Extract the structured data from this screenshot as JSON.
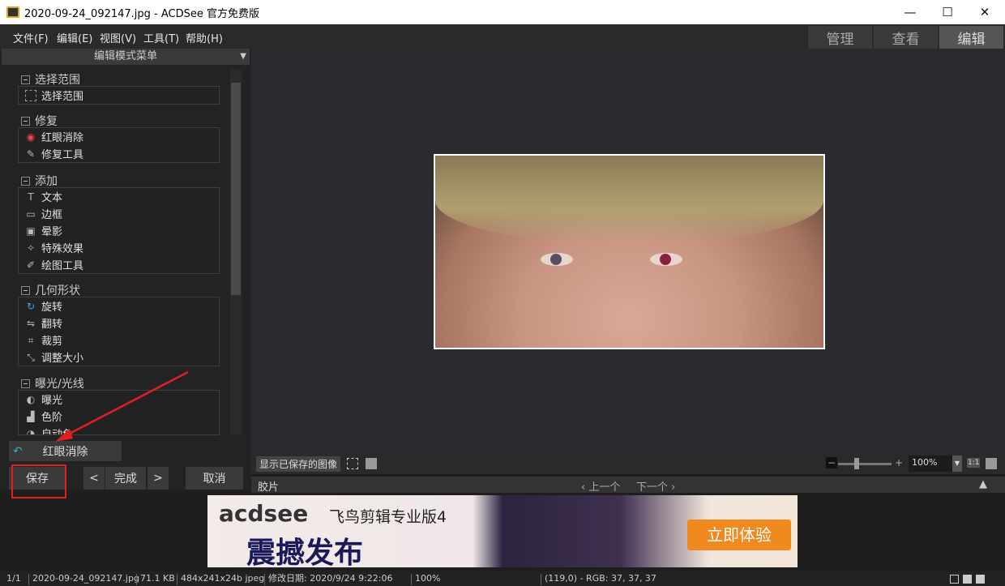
{
  "title": "2020-09-24_092147.jpg - ACDSee 官方免费版",
  "window_controls": {
    "minimize": "—",
    "maximize": "☐",
    "close": "✕"
  },
  "menu": [
    "文件(F)",
    "编辑(E)",
    "视图(V)",
    "工具(T)",
    "帮助(H)"
  ],
  "modes": [
    "管理",
    "查看",
    "编辑"
  ],
  "active_mode": "编辑",
  "panel": {
    "header": "编辑模式菜单",
    "sections": [
      {
        "title": "选择范围",
        "items": [
          "选择范围"
        ]
      },
      {
        "title": "修复",
        "items": [
          "红眼消除",
          "修复工具"
        ]
      },
      {
        "title": "添加",
        "items": [
          "文本",
          "边框",
          "晕影",
          "特殊效果",
          "绘图工具"
        ]
      },
      {
        "title": "几何形状",
        "items": [
          "旋转",
          "翻转",
          "裁剪",
          "调整大小"
        ]
      },
      {
        "title": "曝光/光线",
        "items": [
          "曝光",
          "色阶",
          "自动色"
        ]
      }
    ]
  },
  "history_label": "红眼消除",
  "buttons": {
    "save": "保存",
    "prev": "<",
    "done": "完成",
    "next": ">",
    "cancel": "取消"
  },
  "toolbar": {
    "show_saved": "显示已保存的图像",
    "zoom": "100%",
    "one_to_one": "1:1",
    "minus": "−",
    "plus": "+"
  },
  "filmstrip": {
    "label": "胶片",
    "prev": "‹ 上一个",
    "next": "下一个 ›"
  },
  "ad": {
    "brand": "acdsee",
    "product": "飞鸟剪辑专业版4",
    "headline": "震撼发布",
    "cta": "立即体验"
  },
  "status": {
    "index": "1/1",
    "filename": "2020-09-24_092147.jpg",
    "size": "71.1 KB",
    "dims": "484x241x24b jpeg",
    "modified": "修改日期: 2020/9/24 9:22:06",
    "zoom": "100%",
    "pixel": "(119,0) - RGB: 37, 37, 37"
  },
  "colors": {
    "accent_red": "#e02020",
    "panel_bg": "#232323"
  }
}
